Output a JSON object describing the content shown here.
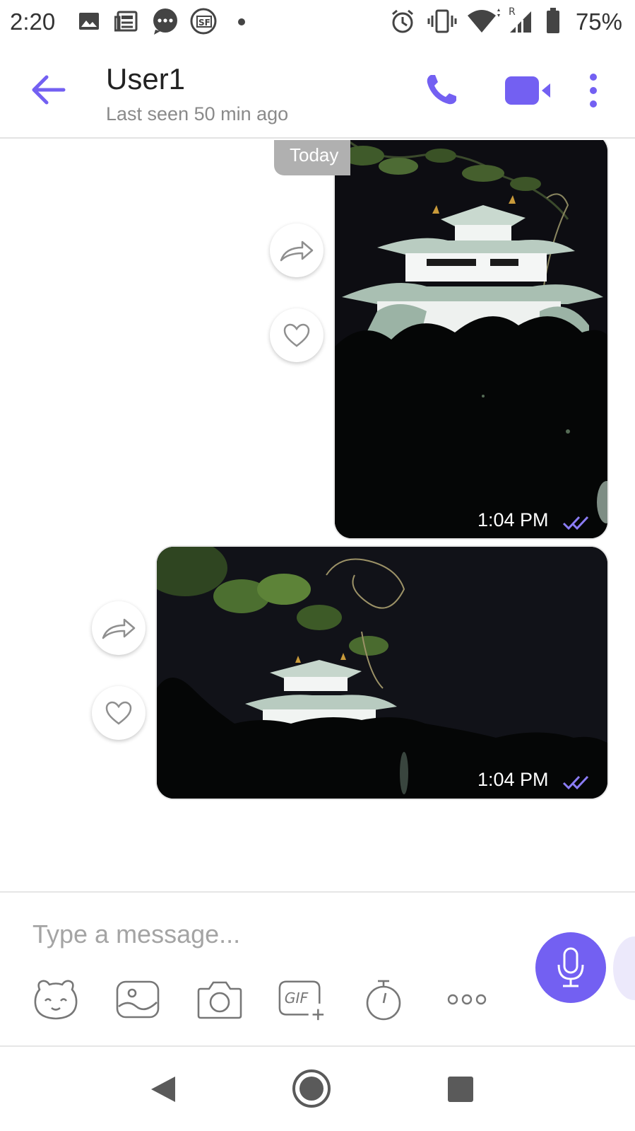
{
  "status_bar": {
    "time": "2:20",
    "battery_percent": "75%",
    "battery_level": 0.75,
    "left_icons": [
      "gallery-icon",
      "news-icon",
      "chat-bubble-icon",
      "sf-app-icon",
      "notification-dot-icon"
    ],
    "right_icons": [
      "alarm-icon",
      "vibrate-icon",
      "wifi-icon",
      "signal-icon",
      "battery-icon"
    ]
  },
  "header": {
    "contact_name": "User1",
    "contact_status": "Last seen 50 min ago",
    "accent_color": "#7360f2"
  },
  "chat": {
    "date_separator": "Today",
    "messages": [
      {
        "type": "photo",
        "subject": "castle-at-night-portrait",
        "time": "1:04 PM",
        "status": "read"
      },
      {
        "type": "photo",
        "subject": "castle-at-night-landscape",
        "time": "1:04 PM",
        "status": "read"
      }
    ]
  },
  "composer": {
    "placeholder": "Type a message...",
    "tools": [
      "sticker-icon",
      "gallery-icon",
      "camera-icon",
      "gif-icon",
      "timer-icon",
      "more-options-icon"
    ],
    "gif_label": "GIF"
  },
  "nav_bar": {
    "buttons": [
      "back-nav",
      "home-nav",
      "recents-nav"
    ]
  }
}
